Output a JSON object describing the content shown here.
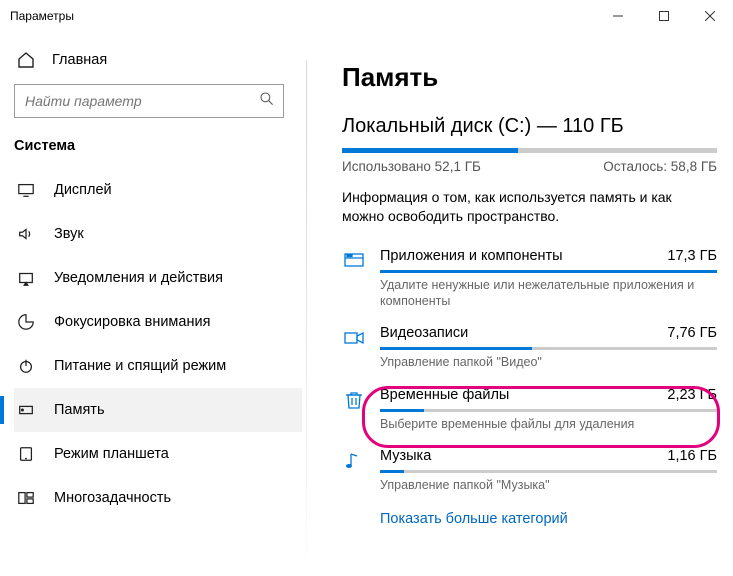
{
  "window": {
    "title": "Параметры"
  },
  "sidebar": {
    "home": "Главная",
    "search_placeholder": "Найти параметр",
    "group": "Система",
    "items": [
      {
        "label": "Дисплей"
      },
      {
        "label": "Звук"
      },
      {
        "label": "Уведомления и действия"
      },
      {
        "label": "Фокусировка внимания"
      },
      {
        "label": "Питание и спящий режим"
      },
      {
        "label": "Память"
      },
      {
        "label": "Режим планшета"
      },
      {
        "label": "Многозадачность"
      }
    ]
  },
  "main": {
    "heading": "Память",
    "disk_title": "Локальный диск (C:) — 110 ГБ",
    "used_label": "Использовано 52,1 ГБ",
    "free_label": "Осталось: 58,8 ГБ",
    "used_percent": 47,
    "info": "Информация о том, как используется память и как можно освободить пространство.",
    "categories": [
      {
        "title": "Приложения и компоненты",
        "size": "17,3 ГБ",
        "sub": "Удалите ненужные или нежелательные приложения и компоненты",
        "fill": 100
      },
      {
        "title": "Видеозаписи",
        "size": "7,76 ГБ",
        "sub": "Управление папкой \"Видео\"",
        "fill": 45
      },
      {
        "title": "Временные файлы",
        "size": "2,23 ГБ",
        "sub": "Выберите временные файлы для удаления",
        "fill": 13
      },
      {
        "title": "Музыка",
        "size": "1,16 ГБ",
        "sub": "Управление папкой \"Музыка\"",
        "fill": 7
      }
    ],
    "more_link": "Показать больше категорий"
  }
}
